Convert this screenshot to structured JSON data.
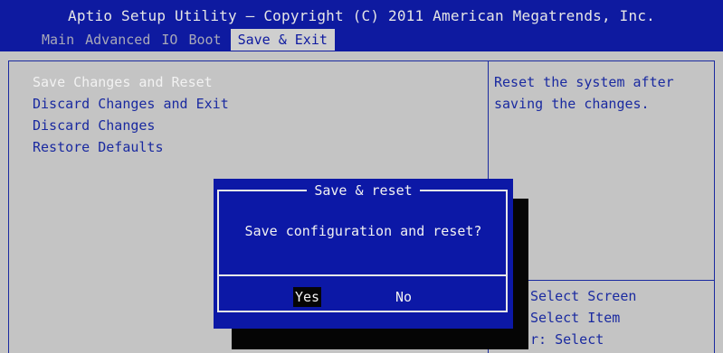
{
  "header": {
    "title": "Aptio Setup Utility – Copyright (C) 2011 American Megatrends, Inc.",
    "tabs": [
      {
        "label": "Main"
      },
      {
        "label": "Advanced"
      },
      {
        "label": "IO"
      },
      {
        "label": "Boot"
      },
      {
        "label": "Save & Exit"
      }
    ],
    "active_tab": "Save & Exit"
  },
  "menu": {
    "items": [
      {
        "label": "Save Changes and Reset",
        "selected": true
      },
      {
        "label": "Discard Changes and Exit"
      },
      {
        "label": "Discard Changes"
      },
      {
        "label": "Restore Defaults"
      }
    ]
  },
  "help": {
    "text": "Reset the system after saving the changes."
  },
  "keys": {
    "lines": [
      "Select Screen",
      "Select Item",
      "r: Select"
    ]
  },
  "dialog": {
    "title": "Save & reset",
    "message": "Save configuration and reset?",
    "yes_label": "Yes",
    "no_label": "No",
    "focused": "Yes"
  },
  "colors": {
    "bios_blue": "#0e1aa0",
    "background_gray": "#c4c4c4",
    "highlight_white": "#f2f2f2"
  }
}
